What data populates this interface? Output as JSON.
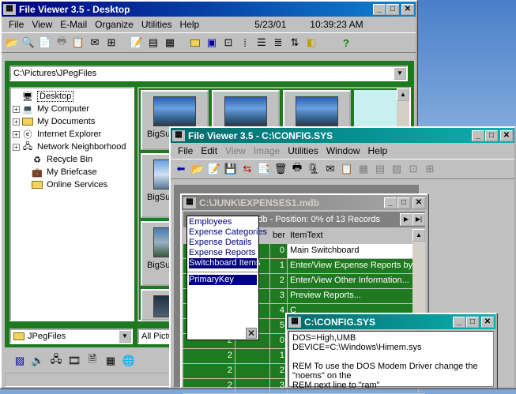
{
  "main_window": {
    "title": "File Viewer 3.5 - Desktop",
    "menu": [
      "File",
      "View",
      "E-Mail",
      "Organize",
      "Utilities",
      "Help"
    ],
    "date": "5/23/01",
    "time": "10:39:23 AM",
    "path": "C:\\Pictures\\JPegFiles",
    "tree": [
      {
        "label": "Desktop",
        "expander": "",
        "icon": "desktop-icon",
        "selected": true
      },
      {
        "label": "My Computer",
        "expander": "+",
        "icon": "computer-icon"
      },
      {
        "label": "My Documents",
        "expander": "+",
        "icon": "folder-icon"
      },
      {
        "label": "Internet Explorer",
        "expander": "+",
        "icon": "ie-icon"
      },
      {
        "label": "Network Neighborhood",
        "expander": "+",
        "icon": "network-icon"
      },
      {
        "label": "Recycle Bin",
        "expander": "",
        "icon": "recycle-icon"
      },
      {
        "label": "My Briefcase",
        "expander": "",
        "icon": "briefcase-icon"
      },
      {
        "label": "Online Services",
        "expander": "",
        "icon": "folder-icon"
      }
    ],
    "thumbnails": [
      "BigSu",
      "",
      "",
      "BigSu",
      "BigSu"
    ],
    "folder_combo": "JPegFiles",
    "filter_combo": "All Pictu"
  },
  "viewer_window": {
    "title": "File Viewer 3.5 - C:\\CONFIG.SYS",
    "menu": [
      {
        "label": "File",
        "disabled": false
      },
      {
        "label": "Edit",
        "disabled": false
      },
      {
        "label": "View",
        "disabled": true
      },
      {
        "label": "Image",
        "disabled": true
      },
      {
        "label": "Utilities",
        "disabled": false
      },
      {
        "label": "Window",
        "disabled": false
      },
      {
        "label": "Help",
        "disabled": false
      }
    ]
  },
  "db_window": {
    "title": "C:\\JUNK\\EXPENSES1.mdb",
    "status": "1.mdb - Position:  0%  of  13 Records",
    "tables": [
      "Employees",
      "Expense Categories",
      "Expense Details",
      "Expense Reports",
      "Switchboard Items"
    ],
    "fields": [
      "PrimaryKey"
    ],
    "col_headers": [
      "ber",
      "ItemText"
    ],
    "rows": [
      [
        "0",
        "Main Switchboard"
      ],
      [
        "1",
        "Enter/View Expense Reports by E"
      ],
      [
        "2",
        "Enter/View Other Information..."
      ],
      [
        "3",
        "Preview Reports..."
      ],
      [
        "4",
        "C"
      ],
      [
        "5",
        "E"
      ],
      [
        "2",
        "0",
        "F"
      ],
      [
        "2",
        "1",
        "E"
      ],
      [
        "2",
        "2",
        "E"
      ],
      [
        "2",
        "3",
        "E"
      ]
    ]
  },
  "config_window": {
    "title": "C:\\CONFIG.SYS",
    "lines": [
      "DOS=High,UMB",
      "DEVICE=C:\\Windows\\Himem.sys",
      "",
      "REM To use the DOS Modem Driver change the",
      "\"noems\" on the",
      "REM next line to \"ram\""
    ]
  }
}
